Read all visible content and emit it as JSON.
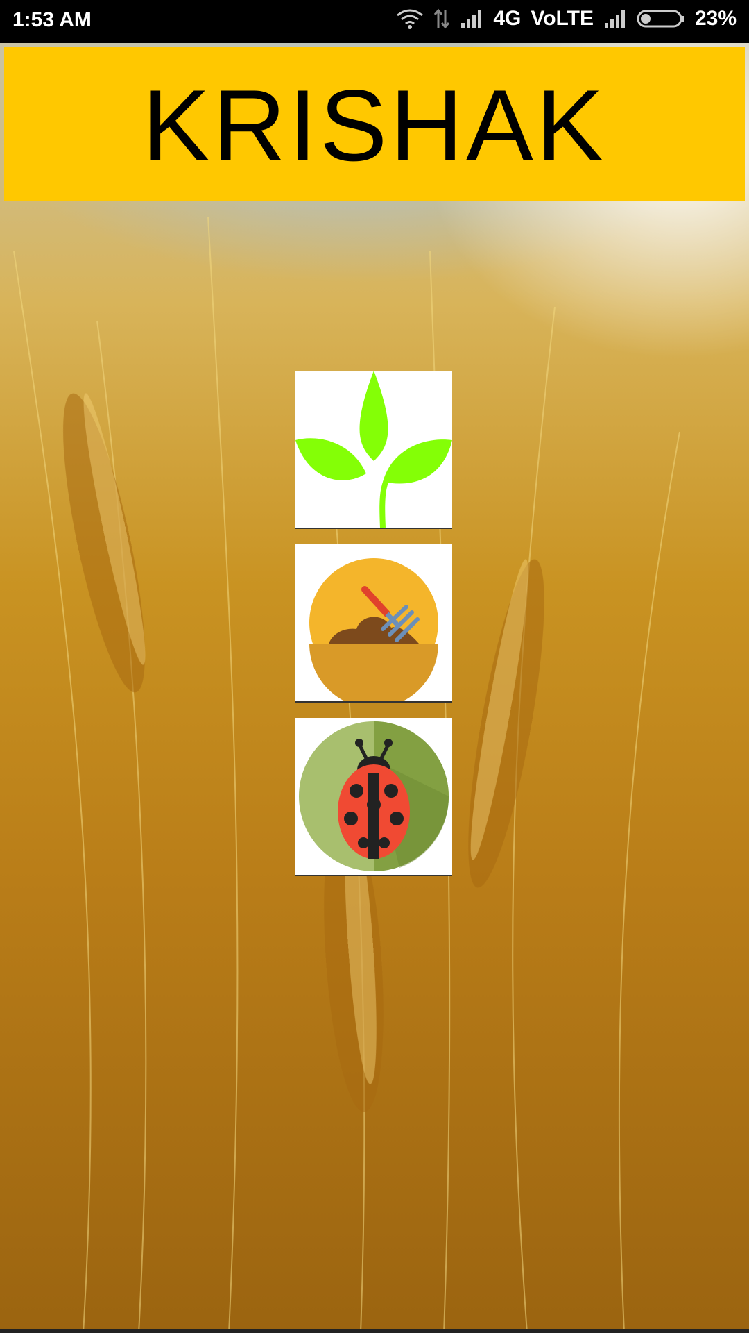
{
  "status_bar": {
    "time": "1:53 AM",
    "network": "4G",
    "volte": "VoLTE",
    "battery": "23%"
  },
  "header": {
    "title": "KRISHAK",
    "color": "#ffc800"
  },
  "menu_tiles": [
    {
      "icon": "plant-sprout-icon"
    },
    {
      "icon": "soil-hoe-icon"
    },
    {
      "icon": "ladybug-pest-icon"
    }
  ]
}
